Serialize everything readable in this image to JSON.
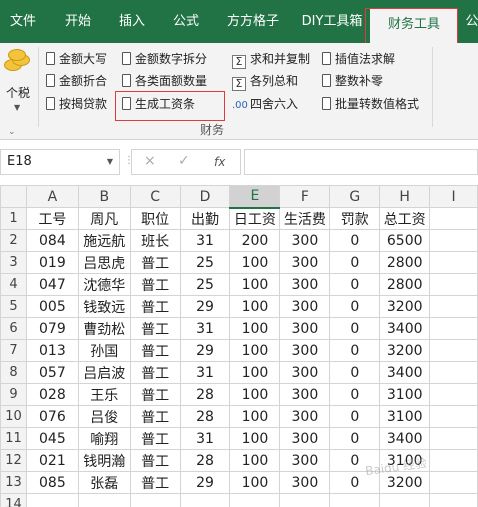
{
  "tabs": [
    {
      "label": "文件"
    },
    {
      "label": "开始"
    },
    {
      "label": "插入"
    },
    {
      "label": "公式"
    },
    {
      "label": "方方格子"
    },
    {
      "label": "DIY工具箱"
    },
    {
      "label": "财务工具"
    },
    {
      "label": "公"
    }
  ],
  "active_tab": "财务工具",
  "ribbon": {
    "tax_label": "个税",
    "group_name": "财务",
    "col1": [
      "金额大写",
      "金额折合",
      "按揭贷款"
    ],
    "col2": [
      "金额数字拆分",
      "各类面额数量",
      "生成工资条"
    ],
    "col3": [
      "求和并复制",
      "各列总和",
      "四舍六入"
    ],
    "col4": [
      "插值法求解",
      "整数补零",
      "批量转数值格式"
    ],
    "round_icon_text": ".00"
  },
  "formula_bar": {
    "name_box": "E18",
    "cancel_icon": "×",
    "confirm_icon": "✓",
    "fx_label": "fx",
    "formula": ""
  },
  "grid": {
    "columns": [
      "A",
      "B",
      "C",
      "D",
      "E",
      "F",
      "G",
      "H",
      "I"
    ],
    "selected_column": "E",
    "headers": [
      "工号",
      "周凡",
      "职位",
      "出勤",
      "日工资",
      "生活费",
      "罚款",
      "总工资"
    ],
    "rows": [
      [
        "084",
        "施远航",
        "班长",
        "31",
        "200",
        "300",
        "0",
        "6500"
      ],
      [
        "019",
        "吕思虎",
        "普工",
        "25",
        "100",
        "300",
        "0",
        "2800"
      ],
      [
        "047",
        "沈德华",
        "普工",
        "25",
        "100",
        "300",
        "0",
        "2800"
      ],
      [
        "005",
        "钱致远",
        "普工",
        "29",
        "100",
        "300",
        "0",
        "3200"
      ],
      [
        "079",
        "曹劲松",
        "普工",
        "31",
        "100",
        "300",
        "0",
        "3400"
      ],
      [
        "013",
        "孙国",
        "普工",
        "29",
        "100",
        "300",
        "0",
        "3200"
      ],
      [
        "057",
        "吕启波",
        "普工",
        "31",
        "100",
        "300",
        "0",
        "3400"
      ],
      [
        "028",
        "王乐",
        "普工",
        "28",
        "100",
        "300",
        "0",
        "3100"
      ],
      [
        "076",
        "吕俊",
        "普工",
        "28",
        "100",
        "300",
        "0",
        "3100"
      ],
      [
        "045",
        "喻翔",
        "普工",
        "31",
        "100",
        "300",
        "0",
        "3400"
      ],
      [
        "021",
        "钱明瀚",
        "普工",
        "28",
        "100",
        "300",
        "0",
        "3100"
      ],
      [
        "085",
        "张磊",
        "普工",
        "29",
        "100",
        "300",
        "0",
        "3200"
      ]
    ],
    "row_numbers": [
      "1",
      "2",
      "3",
      "4",
      "5",
      "6",
      "7",
      "8",
      "9",
      "10",
      "11",
      "12",
      "13",
      "14"
    ]
  },
  "watermark": "Baidu 经验",
  "colors": {
    "excel_green": "#217346",
    "highlight_red": "#e0393e",
    "ribbon_bg": "#f3f3f3"
  }
}
